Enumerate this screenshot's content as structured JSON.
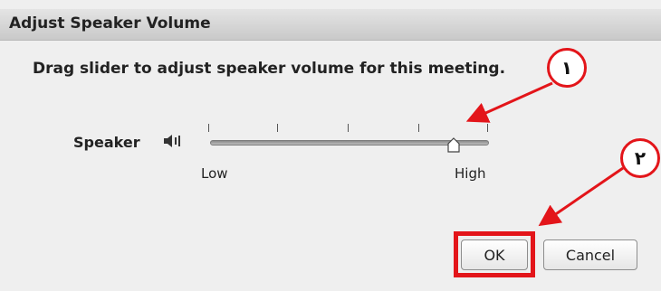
{
  "dialog": {
    "title": "Adjust Speaker Volume",
    "instruction": "Drag slider to adjust speaker volume for this meeting."
  },
  "speaker": {
    "label": "Speaker",
    "icon": "speaker-icon",
    "slider": {
      "min_label": "Low",
      "max_label": "High",
      "value_fraction": 0.88,
      "tick_count": 5
    }
  },
  "buttons": {
    "ok": "OK",
    "cancel": "Cancel"
  },
  "annotations": {
    "marker_1": "١",
    "marker_2": "٢",
    "accent_color": "#e3151a"
  }
}
